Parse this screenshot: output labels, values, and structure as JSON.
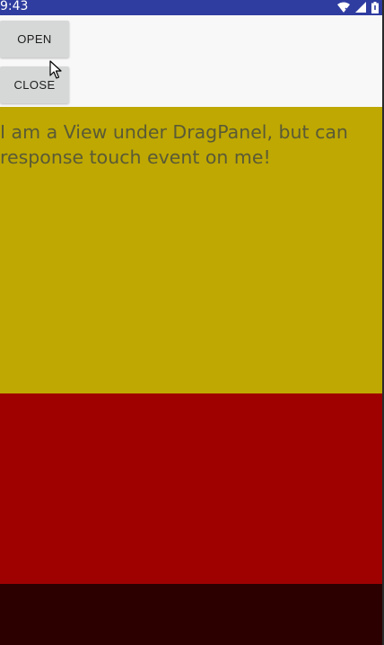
{
  "status_bar": {
    "time": "9:43",
    "icons": [
      "wifi-icon",
      "signal-icon",
      "battery-icon"
    ],
    "background": "#2f3da0"
  },
  "buttons": {
    "open_label": "OPEN",
    "close_label": "CLOSE"
  },
  "content": {
    "under_view_text": "I am a View under DragPanel, but can response touch event on me!",
    "under_view_color": "#bfa801",
    "drag_panel_color": "#9f0101",
    "bottom_panel_color": "#2d0000"
  }
}
